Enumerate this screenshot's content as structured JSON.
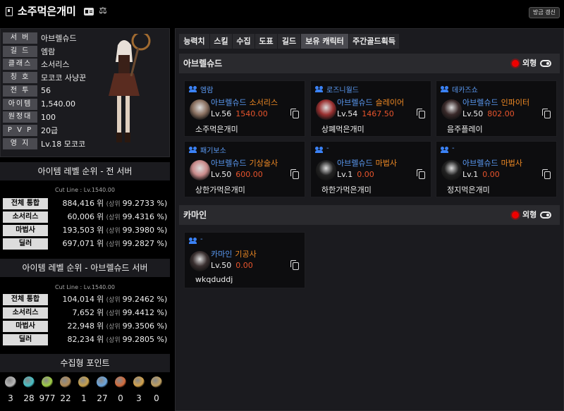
{
  "header": {
    "title": "소주먹은개미",
    "refresh_label": "방금 갱신"
  },
  "profile": {
    "rows": [
      {
        "label": "서 버",
        "value": "아브렐슈드"
      },
      {
        "label": "길 드",
        "value": "엠람"
      },
      {
        "label": "클래스",
        "value": "소서리스"
      },
      {
        "label": "칭 호",
        "value": "모코코 사냥꾼"
      },
      {
        "label": "전 투",
        "value": "56"
      },
      {
        "label": "아이템",
        "value": "1,540.00"
      },
      {
        "label": "원정대",
        "value": "100"
      },
      {
        "label": "P V P",
        "value": "20급"
      },
      {
        "label": "영 지",
        "value": "Lv.18 모코코"
      }
    ]
  },
  "rank_all": {
    "title": "아이템 레벨 순위 - 전 서버",
    "cutline": "Cut Line : Lv.1540.00",
    "rows": [
      {
        "label": "전체 통합",
        "rank": "884,416",
        "unit": "위",
        "sub": "(상위",
        "pct": "99.2733 %)"
      },
      {
        "label": "소서리스",
        "rank": "60,006",
        "unit": "위",
        "sub": "(상위",
        "pct": "99.4316 %)"
      },
      {
        "label": "마법사",
        "rank": "193,503",
        "unit": "위",
        "sub": "(상위",
        "pct": "99.3980 %)"
      },
      {
        "label": "딜러",
        "rank": "697,071",
        "unit": "위",
        "sub": "(상위",
        "pct": "99.2827 %)"
      }
    ]
  },
  "rank_server": {
    "title": "아이템 레벨 순위 - 아브렐슈드 서버",
    "cutline": "Cut Line : Lv.1540.00",
    "rows": [
      {
        "label": "전체 통합",
        "rank": "104,014",
        "unit": "위",
        "sub": "(상위",
        "pct": "99.2462 %)"
      },
      {
        "label": "소서리스",
        "rank": "7,652",
        "unit": "위",
        "sub": "(상위",
        "pct": "99.4412 %)"
      },
      {
        "label": "마법사",
        "rank": "22,948",
        "unit": "위",
        "sub": "(상위",
        "pct": "99.3506 %)"
      },
      {
        "label": "딜러",
        "rank": "82,234",
        "unit": "위",
        "sub": "(상위",
        "pct": "99.2805 %)"
      }
    ]
  },
  "collection": {
    "title": "수집형 포인트",
    "items": [
      {
        "icon": "mokoko-seed-icon",
        "value": "3",
        "color": "#b8b8b8"
      },
      {
        "icon": "island-heart-icon",
        "value": "28",
        "color": "#46c1c7"
      },
      {
        "icon": "giant-heart-icon",
        "value": "977",
        "color": "#9fce44"
      },
      {
        "icon": "art-icon",
        "value": "22",
        "color": "#b08a55"
      },
      {
        "icon": "voyage-icon",
        "value": "1",
        "color": "#c9a14a"
      },
      {
        "icon": "world-tree-leaf-icon",
        "value": "27",
        "color": "#6aa6e0"
      },
      {
        "icon": "orpheus-star-icon",
        "value": "0",
        "color": "#d46a3a"
      },
      {
        "icon": "igneas-token-icon",
        "value": "3",
        "color": "#d4a24a"
      },
      {
        "icon": "sea-bounty-icon",
        "value": "0",
        "color": "#c0a060"
      }
    ]
  },
  "tabs": [
    "능력치",
    "스킬",
    "수집",
    "도표",
    "길드",
    "보유 캐릭터",
    "주간골드획득"
  ],
  "groups": [
    {
      "name": "아브렐슈드",
      "option": "외형",
      "cards": [
        {
          "guild": "엠람",
          "server": "아브렐슈드",
          "cls": "소서리스",
          "lv": "Lv.56",
          "ilvl": "1540.00",
          "name": "소주먹은개미",
          "avatar_color": "#8a7060"
        },
        {
          "guild": "로즈니월드",
          "server": "아브렐슈드",
          "cls": "슬레이어",
          "lv": "Lv.54",
          "ilvl": "1467.50",
          "name": "상폐먹은개미",
          "avatar_color": "#9a3030"
        },
        {
          "guild": "데카즈쇼",
          "server": "아브렐슈드",
          "cls": "인파이터",
          "lv": "Lv.50",
          "ilvl": "802.00",
          "name": "음주플레이",
          "avatar_color": "#3a2a2a"
        },
        {
          "guild": "패기보소",
          "server": "아브렐슈드",
          "cls": "기상술사",
          "lv": "Lv.50",
          "ilvl": "600.00",
          "name": "상한가먹은개미",
          "avatar_color": "#c98a8a"
        },
        {
          "guild": "-",
          "server": "아브렐슈드",
          "cls": "마법사",
          "lv": "Lv.1",
          "ilvl": "0.00",
          "name": "하한가먹은개미",
          "avatar_color": "#222"
        },
        {
          "guild": "-",
          "server": "아브렐슈드",
          "cls": "마법사",
          "lv": "Lv.1",
          "ilvl": "0.00",
          "name": "정지먹은개미",
          "avatar_color": "#222"
        }
      ]
    },
    {
      "name": "카마인",
      "option": "외형",
      "cards": [
        {
          "guild": "-",
          "server": "카마인",
          "cls": "기공사",
          "lv": "Lv.50",
          "ilvl": "0.00",
          "name": "wkqduddj",
          "avatar_color": "#3a3030"
        }
      ]
    }
  ]
}
